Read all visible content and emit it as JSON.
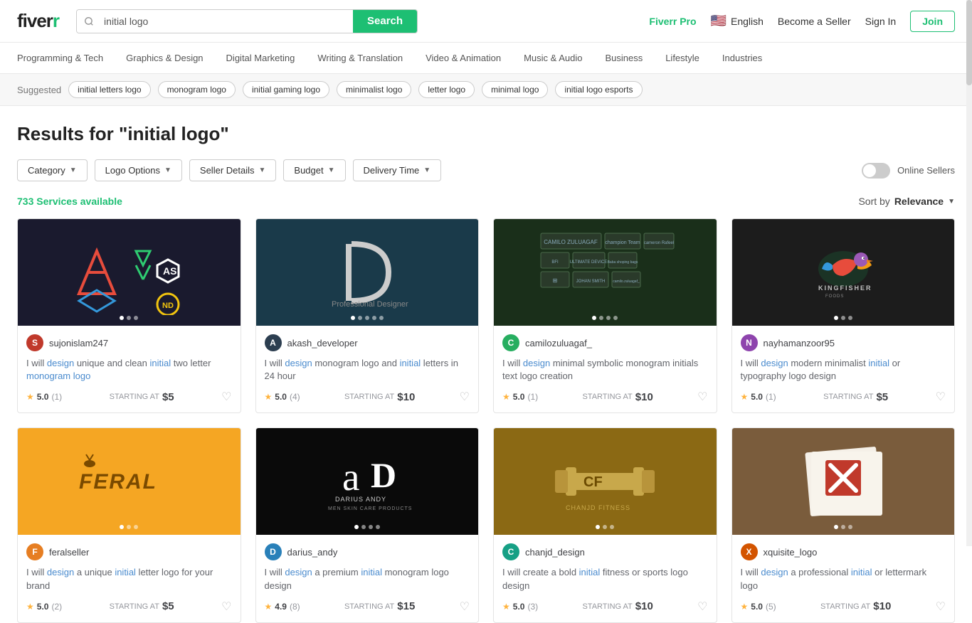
{
  "header": {
    "logo": "fiverr",
    "search_placeholder": "initial logo",
    "search_button": "Search",
    "fiverr_pro": "Fiverr Pro",
    "language": "English",
    "become_seller": "Become a Seller",
    "sign_in": "Sign In",
    "join": "Join"
  },
  "nav": {
    "items": [
      "Programming & Tech",
      "Graphics & Design",
      "Digital Marketing",
      "Writing & Translation",
      "Video & Animation",
      "Music & Audio",
      "Business",
      "Lifestyle",
      "Industries"
    ]
  },
  "suggested": {
    "label": "Suggested",
    "tags": [
      "initial letters logo",
      "monogram logo",
      "initial gaming logo",
      "minimalist logo",
      "letter logo",
      "minimal logo",
      "initial logo esports"
    ]
  },
  "results": {
    "title": "Results for \"initial logo\"",
    "count": "733",
    "count_label": "Services available",
    "sort_label": "Sort by",
    "sort_value": "Relevance"
  },
  "filters": [
    {
      "id": "category",
      "label": "Category"
    },
    {
      "id": "logo-options",
      "label": "Logo Options"
    },
    {
      "id": "seller-details",
      "label": "Seller Details"
    },
    {
      "id": "budget",
      "label": "Budget"
    },
    {
      "id": "delivery-time",
      "label": "Delivery Time"
    }
  ],
  "online_sellers": "Online Sellers",
  "cards": [
    {
      "id": 1,
      "seller": "sujonislam247",
      "avatar_letter": "S",
      "avatar_class": "av1",
      "title": "I will design unique and clean initial two letter monogram logo",
      "title_highlight": [
        "design",
        "unique",
        "clean",
        "initial",
        "two",
        "letter",
        "monogram"
      ],
      "rating": "5.0",
      "reviews": "1",
      "starting_at": "STARTING AT",
      "price": "$5",
      "dots": 3,
      "active_dot": 0,
      "img_class": "img-dark"
    },
    {
      "id": 2,
      "seller": "akash_developer",
      "avatar_letter": "A",
      "avatar_class": "av2",
      "title": "I will design monogram logo and initial letters in 24 hour",
      "rating": "5.0",
      "reviews": "4",
      "starting_at": "STARTING AT",
      "price": "$10",
      "dots": 5,
      "active_dot": 0,
      "img_class": "img-teal"
    },
    {
      "id": 3,
      "seller": "camilozuluagaf_",
      "avatar_letter": "C",
      "avatar_class": "av3",
      "title": "I will design minimal symbolic monogram initials text logo creation",
      "rating": "5.0",
      "reviews": "1",
      "starting_at": "STARTING AT",
      "price": "$10",
      "dots": 4,
      "active_dot": 0,
      "img_class": "img-green-dark"
    },
    {
      "id": 4,
      "seller": "nayhamanzoor95",
      "avatar_letter": "N",
      "avatar_class": "av4",
      "title": "I will design modern minimalist initial or typography logo design",
      "rating": "5.0",
      "reviews": "1",
      "starting_at": "STARTING AT",
      "price": "$5",
      "dots": 3,
      "active_dot": 0,
      "img_class": "img-dark2"
    },
    {
      "id": 5,
      "seller": "feralseller",
      "avatar_letter": "F",
      "avatar_class": "av5",
      "title": "I will design a unique initial letter logo for your brand",
      "rating": "5.0",
      "reviews": "2",
      "starting_at": "STARTING AT",
      "price": "$5",
      "dots": 3,
      "active_dot": 0,
      "img_class": "img-yellow"
    },
    {
      "id": 6,
      "seller": "darius_andy",
      "avatar_letter": "D",
      "avatar_class": "av6",
      "title": "I will design a premium initial monogram logo design",
      "rating": "4.9",
      "reviews": "8",
      "starting_at": "STARTING AT",
      "price": "$15",
      "dots": 4,
      "active_dot": 0,
      "img_class": "img-black"
    },
    {
      "id": 7,
      "seller": "chanjd_design",
      "avatar_letter": "C",
      "avatar_class": "av7",
      "title": "I will create a bold initial fitness or sports logo design",
      "rating": "5.0",
      "reviews": "3",
      "starting_at": "STARTING AT",
      "price": "$10",
      "dots": 3,
      "active_dot": 0,
      "img_class": "img-gold"
    },
    {
      "id": 8,
      "seller": "xquisite_logo",
      "avatar_letter": "X",
      "avatar_class": "av8",
      "title": "I will design a professional initial or lettermark logo",
      "rating": "5.0",
      "reviews": "5",
      "starting_at": "STARTING AT",
      "price": "$10",
      "dots": 3,
      "active_dot": 0,
      "img_class": "img-wood"
    }
  ]
}
